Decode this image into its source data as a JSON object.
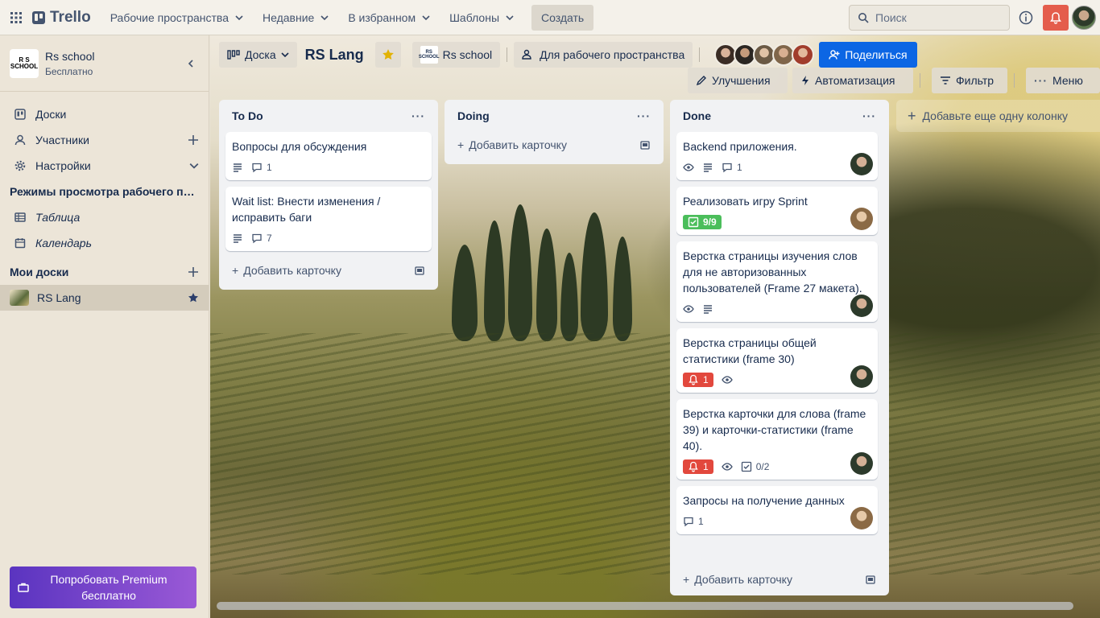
{
  "topbar": {
    "logo": "Trello",
    "nav": [
      {
        "label": "Рабочие пространства"
      },
      {
        "label": "Недавние"
      },
      {
        "label": "В избранном"
      },
      {
        "label": "Шаблоны"
      }
    ],
    "create_label": "Создать",
    "search_placeholder": "Поиск"
  },
  "sidebar": {
    "workspace_name": "Rs school",
    "workspace_plan": "Бесплатно",
    "workspace_logo_text": "RS SCHOOL",
    "items": [
      {
        "label": "Доски"
      },
      {
        "label": "Участники"
      },
      {
        "label": "Настройки"
      }
    ],
    "views_section": "Режимы просмотра рабочего пространства",
    "views": [
      {
        "label": "Таблица"
      },
      {
        "label": "Календарь"
      }
    ],
    "my_boards_section": "Мои доски",
    "boards": [
      {
        "label": "RS Lang"
      }
    ],
    "premium_line1": "Попробовать Premium",
    "premium_line2": "бесплатно"
  },
  "board": {
    "view_label": "Доска",
    "title": "RS Lang",
    "workspace_label": "Rs school",
    "visibility_label": "Для рабочего пространства",
    "share_label": "Поделиться",
    "powerups_label": "Улучшения",
    "automation_label": "Автоматизация",
    "filter_label": "Фильтр",
    "menu_label": "Меню",
    "add_list_label": "Добавьте еще одну колонку",
    "add_card_label": "Добавить карточку"
  },
  "lists": [
    {
      "title": "To Do",
      "cards": [
        {
          "title": "Вопросы для обсуждения",
          "comments": "1"
        },
        {
          "title": "Wait list: Внести изменения / исправить баги",
          "comments": "7"
        }
      ]
    },
    {
      "title": "Doing",
      "cards": []
    },
    {
      "title": "Done",
      "cards": [
        {
          "title": "Backend приложения.",
          "comments": "1"
        },
        {
          "title": "Реализовать игру Sprint",
          "checklist": "9/9"
        },
        {
          "title": "Верстка страницы изучения слов для не авторизованных пользователей (Frame 27 макета)."
        },
        {
          "title": "Верстка страницы общей статистики (frame 30)",
          "notifications": "1"
        },
        {
          "title": "Верстка карточки для слова (frame 39) и карточки-статистики (frame 40).",
          "notifications": "1",
          "checklist": "0/2"
        },
        {
          "title": "Запросы на получение данных",
          "comments": "1"
        }
      ]
    }
  ],
  "colors": {
    "share": "#0c66e4",
    "premium_start": "#5a34c0",
    "premium_end": "#9a59d6",
    "notification": "#e2483d",
    "checklist_done": "#4bbe5b"
  }
}
